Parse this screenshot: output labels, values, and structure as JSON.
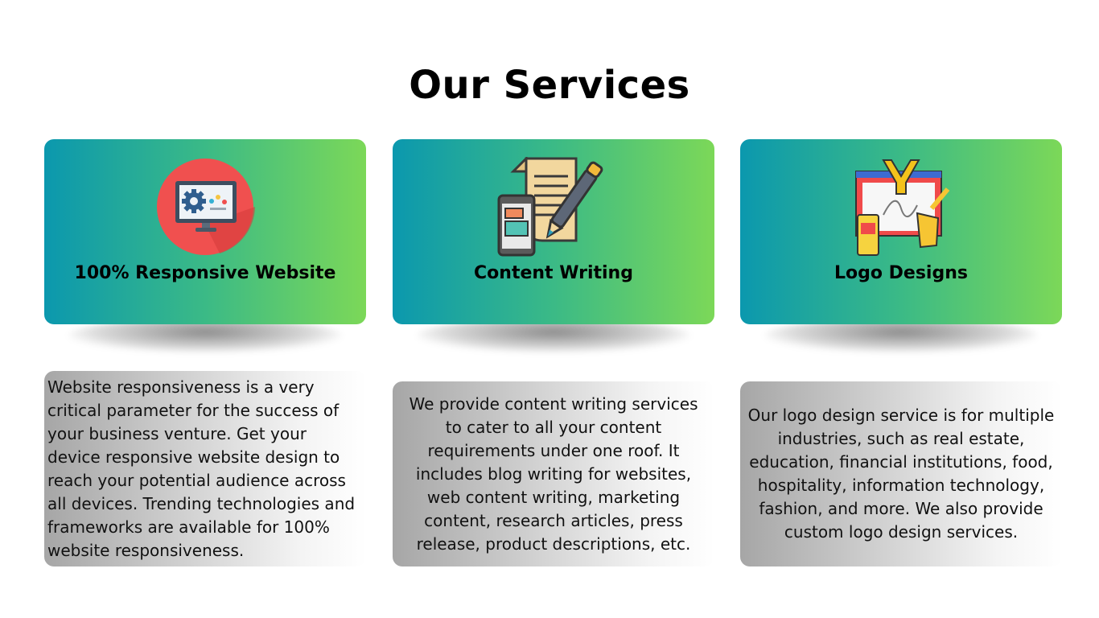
{
  "page": {
    "title": "Our Services"
  },
  "services": [
    {
      "title": "100% Responsive Website",
      "description": "Website responsiveness is a very critical parameter for the success of your business venture. Get your device responsive website design to reach your potential audience across all devices. Trending technologies and frameworks are available for 100% website responsiveness.",
      "icon": "monitor-gear-icon"
    },
    {
      "title": "Content Writing",
      "description": "We provide content writing services to cater to all your content requirements under one roof. It includes blog writing for websites, web content writing, marketing content, research articles, press release, product descriptions, etc.",
      "icon": "document-pen-phone-icon"
    },
    {
      "title": "Logo Designs",
      "description": "Our logo design service is for multiple industries, such as real estate, education, financial institutions, food, hospitality, information technology, fashion, and more. We also provide custom logo design services.",
      "icon": "logo-design-canvas-icon"
    }
  ],
  "colors": {
    "card_gradient_start": "#0b98ae",
    "card_gradient_end": "#7cd858",
    "description_gradient_start": "#a6a6a6",
    "description_gradient_end": "#ffffff"
  }
}
